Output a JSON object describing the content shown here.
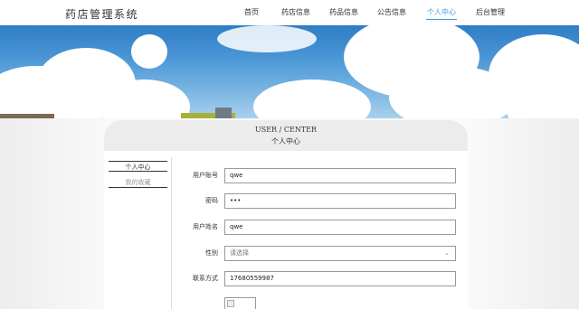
{
  "header": {
    "logo": "药店管理系统",
    "nav": [
      "首页",
      "药店信息",
      "药品信息",
      "公告信息",
      "个人中心",
      "后台管理"
    ],
    "active_index": 4
  },
  "section_title": {
    "en": "USER / CENTER",
    "zh": "个人中心"
  },
  "sidebar": {
    "items": [
      {
        "label": "个人中心",
        "active": true
      },
      {
        "label": "我的收藏",
        "active": false
      }
    ]
  },
  "form": {
    "fields": [
      {
        "label": "用户账号",
        "value": "qwe",
        "type": "text"
      },
      {
        "label": "密码",
        "value": "•••",
        "type": "password"
      },
      {
        "label": "用户姓名",
        "value": "qwe",
        "type": "text"
      },
      {
        "label": "性别",
        "placeholder": "请选择",
        "type": "select"
      },
      {
        "label": "联系方式",
        "value": "17680559987",
        "type": "text"
      }
    ]
  },
  "colors": {
    "accent": "#3c9ddb",
    "nav_text": "#333333"
  },
  "icons": {
    "select_chevron": "chevron-down-icon",
    "broken_image": "broken-image-icon"
  }
}
